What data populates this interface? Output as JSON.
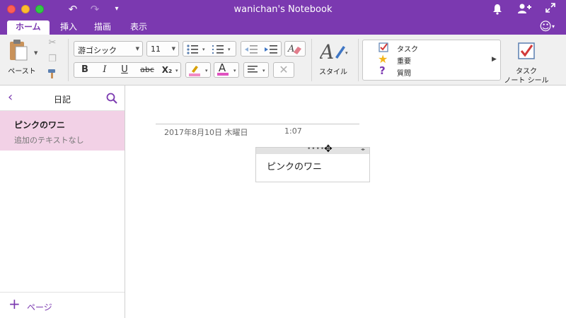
{
  "window": {
    "title": "wanichan's Notebook",
    "undo_icon": "undo-icon",
    "redo_icon": "redo-icon",
    "customize_icon": "customize-toolbar-icon",
    "bell_icon": "bell-icon",
    "add_person_icon": "add-person-icon",
    "fullscreen_icon": "fullscreen-icon"
  },
  "tabs": [
    {
      "label": "ホーム",
      "active": true
    },
    {
      "label": "挿入",
      "active": false
    },
    {
      "label": "描画",
      "active": false
    },
    {
      "label": "表示",
      "active": false
    }
  ],
  "ribbon": {
    "paste_label": "ペースト",
    "font_name": "游ゴシック",
    "font_size": "11",
    "bold": "B",
    "italic": "I",
    "underline": "U",
    "strikethrough": "abc",
    "subscript": "X₂",
    "style_label": "スタイル",
    "tags": [
      {
        "label": "タスク",
        "icon": "checkbox-icon"
      },
      {
        "label": "重要",
        "icon": "star-icon"
      },
      {
        "label": "質問",
        "icon": "question-icon"
      }
    ],
    "task_note_label_1": "タスク",
    "task_note_label_2": "ノート シール",
    "highlight_color": "#f28ac6",
    "font_color": "#e052c0"
  },
  "sidebar": {
    "section_title": "日記",
    "pages": [
      {
        "title": "ピンクのワニ",
        "preview": "追加のテキストなし"
      }
    ],
    "add_page_label": "ページ"
  },
  "note": {
    "date": "2017年8月10日 木曜日",
    "time": "1:07",
    "content": "ピンクのワニ"
  },
  "colors": {
    "accent": "#7b39b0",
    "selected_page": "#f2d1e6"
  }
}
